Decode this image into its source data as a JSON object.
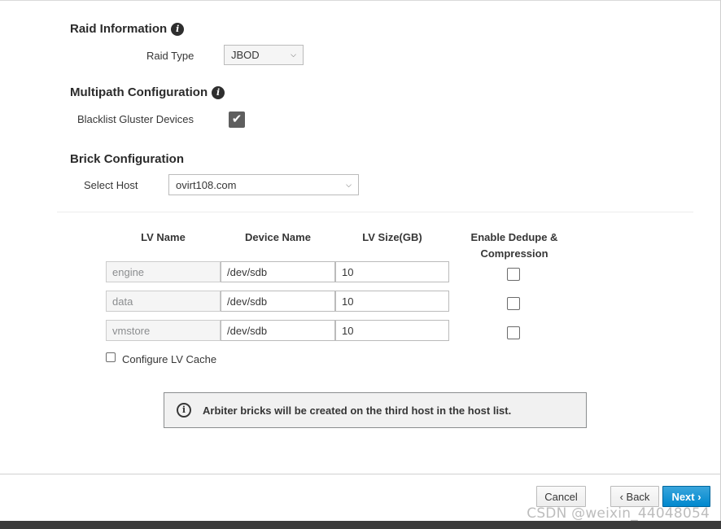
{
  "raid": {
    "title": "Raid Information",
    "info_icon": "i",
    "raid_type_label": "Raid Type",
    "raid_type_value": "JBOD"
  },
  "multipath": {
    "title": "Multipath Configuration",
    "info_icon": "i",
    "blacklist_label": "Blacklist Gluster Devices",
    "blacklist_checked": true,
    "check_glyph": "✔"
  },
  "brick": {
    "title": "Brick Configuration",
    "select_host_label": "Select Host",
    "select_host_value": "ovirt108.com"
  },
  "chevron_glyph": "⌵",
  "table": {
    "headers": {
      "lv_name": "LV Name",
      "device_name": "Device Name",
      "lv_size": "LV Size(GB)",
      "dedupe_line1": "Enable Dedupe &",
      "dedupe_line2": "Compression"
    },
    "rows": [
      {
        "lv_name": "engine",
        "device": "/dev/sdb",
        "size": "10",
        "dedupe": false
      },
      {
        "lv_name": "data",
        "device": "/dev/sdb",
        "size": "10",
        "dedupe": false
      },
      {
        "lv_name": "vmstore",
        "device": "/dev/sdb",
        "size": "10",
        "dedupe": false
      }
    ],
    "lv_cache_label": "Configure LV Cache",
    "lv_cache_checked": false
  },
  "alert": {
    "icon": "i",
    "message": "Arbiter bricks will be created on the third host in the host list."
  },
  "footer": {
    "cancel": "Cancel",
    "back": "‹ Back",
    "next": "Next ›"
  },
  "watermark": "CSDN @weixin_44048054",
  "colors": {
    "primary": "#0088ce",
    "text": "#363636",
    "disabled_bg": "#f5f5f5"
  }
}
